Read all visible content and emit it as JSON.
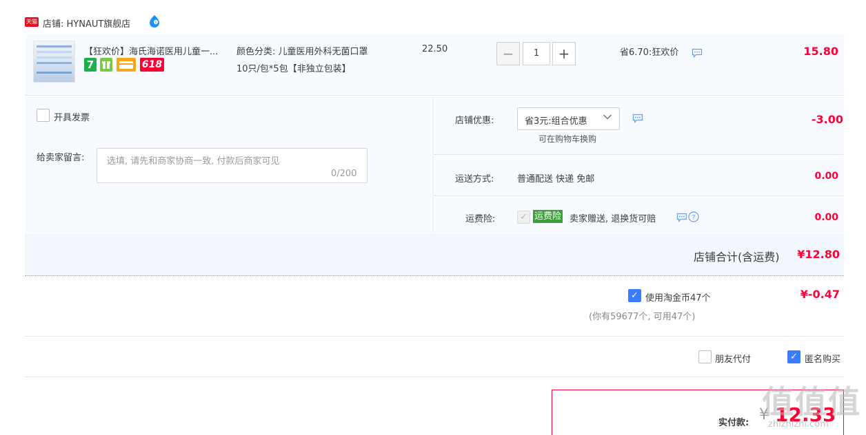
{
  "shop": {
    "badge_text": "天猫",
    "name": "店铺: HYNAUT旗舰店",
    "icon": "wangwang-chat-icon"
  },
  "product": {
    "name": "【狂欢价】海氏海诺医用儿童一...",
    "sku_line1": "颜色分类: 儿童医用外科无菌口罩",
    "sku_line2": "10只/包*5包【非独立包装】",
    "unit_price": "22.50",
    "quantity": "1",
    "minus_label": "−",
    "plus_label": "+",
    "saving": "省6.70:狂欢价",
    "subtotal": "15.80",
    "badges": [
      "7",
      "gift",
      "card",
      "618"
    ]
  },
  "invoice": {
    "label": "开具发票"
  },
  "memo": {
    "label": "给卖家留言:",
    "placeholder": "选填, 请先和商家协商一致, 付款后商家可见",
    "counter": "0/200"
  },
  "discount": {
    "label": "店铺优惠:",
    "selected": "省3元:组合优惠",
    "sub": "可在购物车换购",
    "amount": "-3.00"
  },
  "shipping": {
    "label": "运送方式:",
    "value": "普通配送 快递 免邮",
    "amount": "0.00"
  },
  "insurance": {
    "label": "运费险:",
    "tag": "运费险",
    "text": "卖家赠送, 退换货可赔",
    "amount": "0.00"
  },
  "shop_total": {
    "label": "店铺合计(含运费)",
    "value": "¥12.80"
  },
  "coins": {
    "label": "使用淘金币47个",
    "sub": "(你有59677个, 可用47个)",
    "value": "¥-0.47"
  },
  "options": {
    "friend_pay": "朋友代付",
    "anonymous": "匿名购买"
  },
  "payment": {
    "label": "实付款:",
    "currency": "¥",
    "amount": "12.33"
  },
  "watermark": {
    "main": "值值值",
    "sub": "zhizhizhi.com"
  },
  "colors": {
    "accent_red": "#ff0036",
    "checkbox_blue": "#3b7cff",
    "row_bg": "#f7fafe",
    "insurance_green": "#3aa13a"
  }
}
